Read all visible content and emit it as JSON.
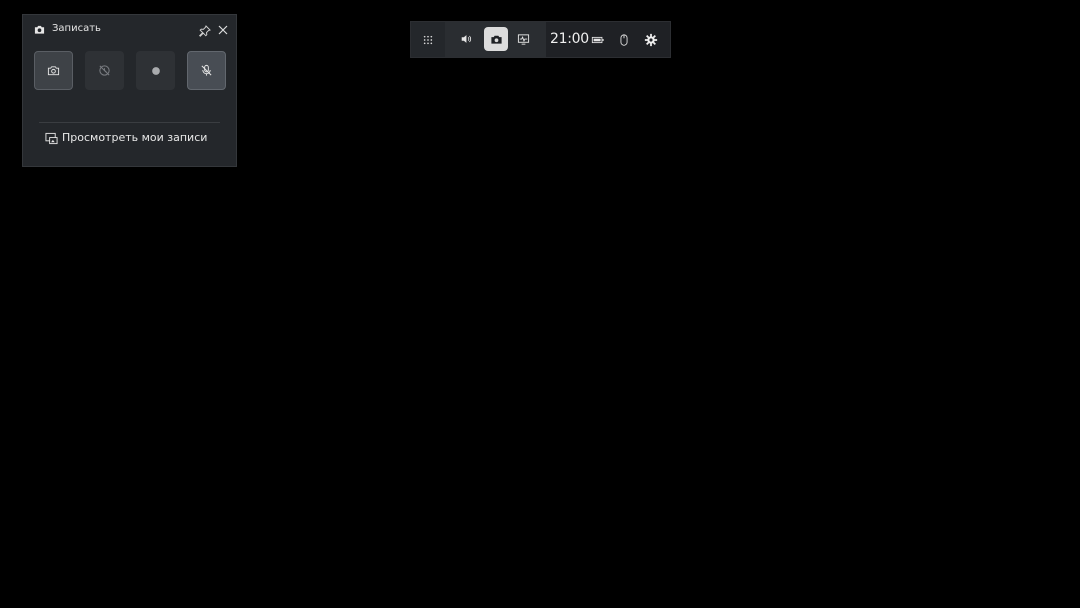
{
  "capture_widget": {
    "title": "Записать",
    "title_icon": "camera-icon",
    "pin_icon": "pin-icon",
    "close_icon": "close-icon",
    "controls": [
      {
        "name": "screenshot",
        "icon": "camera-icon"
      },
      {
        "name": "record-last-30s",
        "icon": "record-history-icon",
        "state": "disabled"
      },
      {
        "name": "start-recording",
        "icon": "record-dot-icon"
      },
      {
        "name": "microphone",
        "icon": "mic-off-icon",
        "state": "muted"
      }
    ],
    "gallery_link": "Просмотреть мои записи",
    "gallery_icon": "gallery-icon"
  },
  "game_bar": {
    "menu_icon": "grid-menu-icon",
    "widgets": [
      {
        "name": "audio",
        "icon": "speaker-icon"
      },
      {
        "name": "capture",
        "icon": "camera-icon",
        "active": true
      },
      {
        "name": "performance",
        "icon": "performance-icon"
      }
    ],
    "time": "21:00",
    "status_icons": [
      "battery-icon",
      "mouse-icon"
    ],
    "settings_icon": "gear-icon"
  },
  "colors": {
    "background": "#000000",
    "panel": "#24272b",
    "bar": "#1f2125",
    "active_button": "#dcdcdc",
    "text": "#e8e8e8"
  }
}
